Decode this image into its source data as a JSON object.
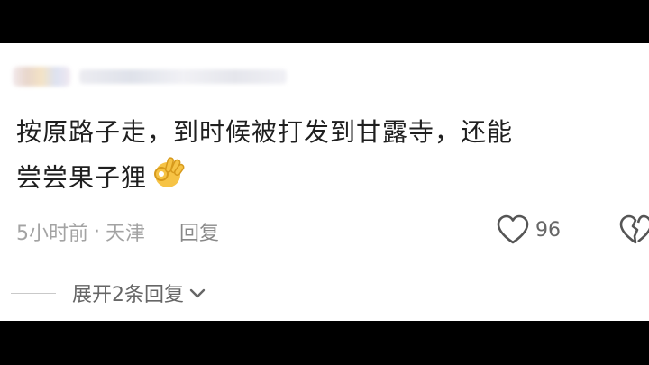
{
  "comment": {
    "line1": "按原路子走，到时候被打发到甘露寺，还能",
    "line2": "尝尝果子狸",
    "emoji": "ok-hand-emoji"
  },
  "meta": {
    "time": "5小时前",
    "separator": "·",
    "location": "天津",
    "reply_label": "回复"
  },
  "likes": {
    "count": "96"
  },
  "expand": {
    "label": "展开2条回复"
  },
  "colors": {
    "text": "#1f1f1f",
    "meta": "#a3a3a3",
    "background": "#ffffff",
    "letterbox": "#000000"
  }
}
